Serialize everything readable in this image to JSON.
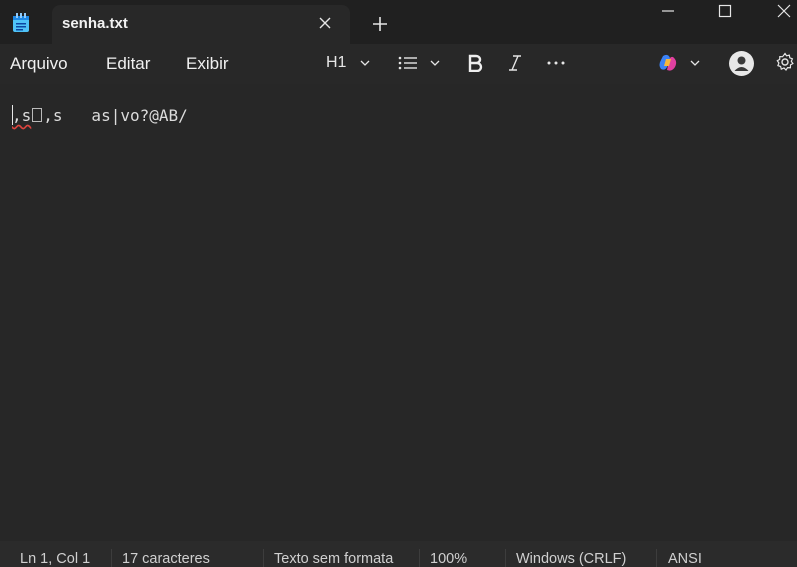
{
  "tab": {
    "title": "senha.txt"
  },
  "menu": {
    "file": "Arquivo",
    "edit": "Editar",
    "view": "Exibir"
  },
  "toolbar": {
    "heading": "H1"
  },
  "editor": {
    "content_a": ",s",
    "content_b": ",s   as|vo?@AB/"
  },
  "status": {
    "position": "Ln 1, Col 1",
    "chars": "17 caracteres",
    "format": "Texto sem formata",
    "zoom": "100%",
    "line_ending": "Windows (CRLF)",
    "encoding": "ANSI"
  },
  "icons": {
    "app": "notepad-icon",
    "close_tab": "close-icon",
    "new_tab": "plus-icon",
    "list": "bulleted-list-icon",
    "bold": "bold-icon",
    "italic": "italic-icon",
    "more": "more-icon",
    "copilot": "copilot-icon",
    "account": "account-icon",
    "settings": "gear-icon"
  },
  "colors": {
    "background": "#272727",
    "titlebar": "#202020",
    "spell_error": "#e0443e"
  }
}
